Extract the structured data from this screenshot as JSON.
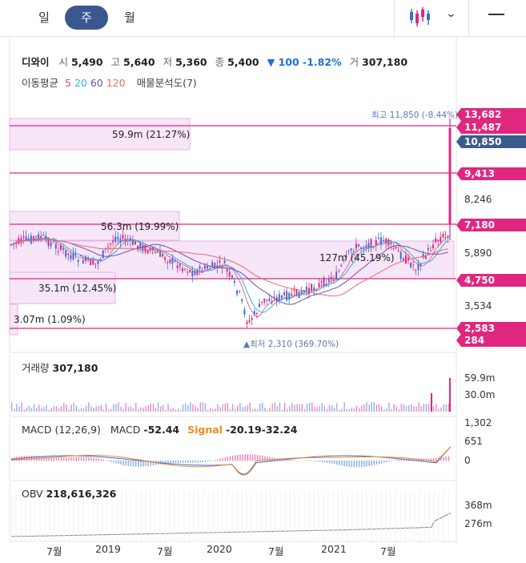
{
  "tabs": [
    "일",
    "주",
    "월"
  ],
  "active_tab": "주",
  "stock": {
    "name": "디와이",
    "open_label": "시",
    "open": "5,490",
    "high_label": "고",
    "high": "5,640",
    "low_label": "저",
    "low": "5,360",
    "close_label": "종",
    "close": "5,400",
    "change": "▼ 100 -1.82%",
    "volume_label": "거",
    "volume": "307,180"
  },
  "legend": {
    "ma_label": "이동평균",
    "ma5": "5",
    "ma20": "20",
    "ma60": "60",
    "ma120": "120",
    "ma5_color": "#e0457b",
    "ma20_color": "#29b6d6",
    "ma60_color": "#6b4fb3",
    "ma120_color": "#e86a6a",
    "profile_label": "매물분석도(7)"
  },
  "colors": {
    "accent": "#3b5691",
    "magenta": "#e0277f",
    "up": "#e0277f",
    "down": "#3b6fd9"
  },
  "price_axis": [
    "13,682",
    "10,850",
    "8,246",
    "5,890",
    "3,534"
  ],
  "price_badges": [
    {
      "text": "11,487",
      "color": "#e0277f"
    },
    {
      "text": "9,413",
      "color": "#e0277f"
    },
    {
      "text": "7,180",
      "color": "#e0277f"
    },
    {
      "text": "4,750",
      "color": "#e0277f"
    },
    {
      "text": "2,583",
      "color": "#e0277f"
    },
    {
      "text": "284",
      "color": "#e0277f"
    }
  ],
  "top_badge": "13,682",
  "current_badge": "10,850",
  "profile_zones": [
    "59.9m (21.27%)",
    "56.3m (19.99%)",
    "127m (45.19%)",
    "35.1m (12.45%)",
    "3.07m (1.09%)"
  ],
  "high_annotation": "최고 11,850 (-8.44%) ▼",
  "low_annotation": "▲최저 2,310 (369.70%)",
  "volume_panel": {
    "label": "거래량",
    "value": "307,180",
    "axis": [
      "59.9m",
      "30.0m"
    ]
  },
  "macd_panel": {
    "label": "MACD (12,26,9)",
    "macd_label": "MACD",
    "macd_value": "-52.44",
    "signal_label": "Signal",
    "signal_value": "-20.19",
    "hist_value": "-32.24",
    "axis": [
      "1,302",
      "651",
      "0"
    ]
  },
  "obv_panel": {
    "label": "OBV",
    "value": "218,616,326",
    "axis": [
      "368m",
      "276m"
    ]
  },
  "x_axis": [
    "7월",
    "2019",
    "7월",
    "2020",
    "7월",
    "2021",
    "7월"
  ]
}
